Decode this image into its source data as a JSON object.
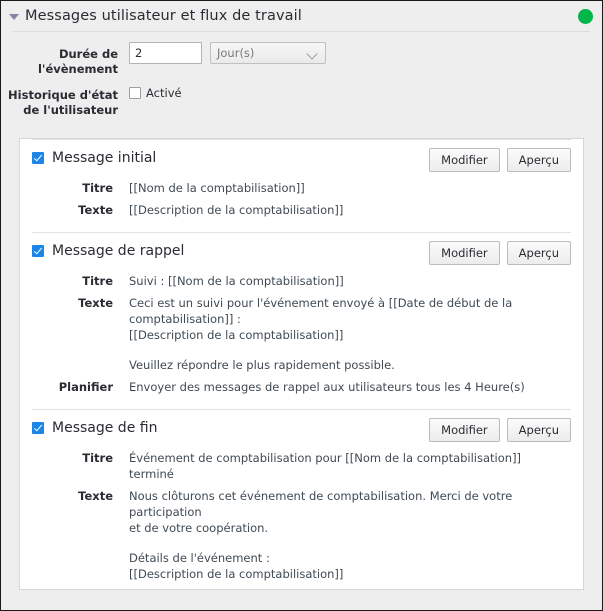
{
  "header": {
    "title": "Messages utilisateur et flux de travail",
    "collapse_icon": "caret-down-icon",
    "status_icon": "status-dot-icon",
    "status_color": "#02b64a"
  },
  "form": {
    "duration": {
      "label": "Durée de l'évènement",
      "value": "2",
      "unit_value": "Jour(s)",
      "chevron_icon": "chevron-down-icon"
    },
    "history": {
      "label": "Historique d'état de l'utilisateur",
      "checkbox_label": "Activé",
      "checked": false
    }
  },
  "buttons": {
    "edit": "Modifier",
    "preview": "Aperçu"
  },
  "sections": [
    {
      "title": "Message initial",
      "checked": true,
      "rows": [
        {
          "key": "Titre",
          "value": "[[Nom de la comptabilisation]]"
        },
        {
          "key": "Texte",
          "value": "[[Description de la comptabilisation]]"
        }
      ]
    },
    {
      "title": "Message de rappel",
      "checked": true,
      "rows": [
        {
          "key": "Titre",
          "value": "Suivi : [[Nom de la comptabilisation]]"
        },
        {
          "key": "Texte",
          "value": "Ceci est un suivi pour l'événement envoyé à [[Date de début de la comptabilisation]] :\n[[Description de la comptabilisation]]"
        },
        {
          "key": "",
          "value": "Veuillez répondre le plus rapidement possible."
        },
        {
          "key": "Planifier",
          "value": "Envoyer des messages de rappel aux utilisateurs tous les 4 Heure(s)"
        }
      ]
    },
    {
      "title": "Message de fin",
      "checked": true,
      "rows": [
        {
          "key": "Titre",
          "value": "Événement de comptabilisation pour [[Nom de la comptabilisation]] terminé"
        },
        {
          "key": "Texte",
          "value": "Nous clôturons cet événement de comptabilisation. Merci de votre participation\n et de votre  coopération."
        },
        {
          "key": "",
          "value": "Détails de l'événement :\n[[Description de la comptabilisation]]"
        }
      ]
    }
  ]
}
